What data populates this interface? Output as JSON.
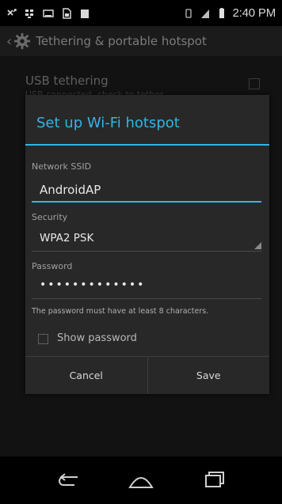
{
  "status_bar": {
    "time": "2:40 PM",
    "icons": [
      "missed-call-icon",
      "bbm-icon",
      "voicemail-icon",
      "sim-icon",
      "notification-icon"
    ],
    "right_icons": [
      "vibrate-icon",
      "signal-icon",
      "battery-icon"
    ]
  },
  "action_bar": {
    "title": "Tethering & portable hotspot"
  },
  "background_settings": {
    "usb_title": "USB tethering",
    "usb_subtitle": "USB connected, check to tether"
  },
  "dialog": {
    "title": "Set up Wi-Fi hotspot",
    "ssid_label": "Network SSID",
    "ssid_value": "AndroidAP",
    "security_label": "Security",
    "security_value": "WPA2 PSK",
    "password_label": "Password",
    "password_value": "•••••••••••••",
    "hint": "The password must have at least 8 characters.",
    "show_password_label": "Show password",
    "cancel_label": "Cancel",
    "save_label": "Save"
  },
  "colors": {
    "accent": "#33b5e5",
    "dialog_bg": "#282828"
  }
}
